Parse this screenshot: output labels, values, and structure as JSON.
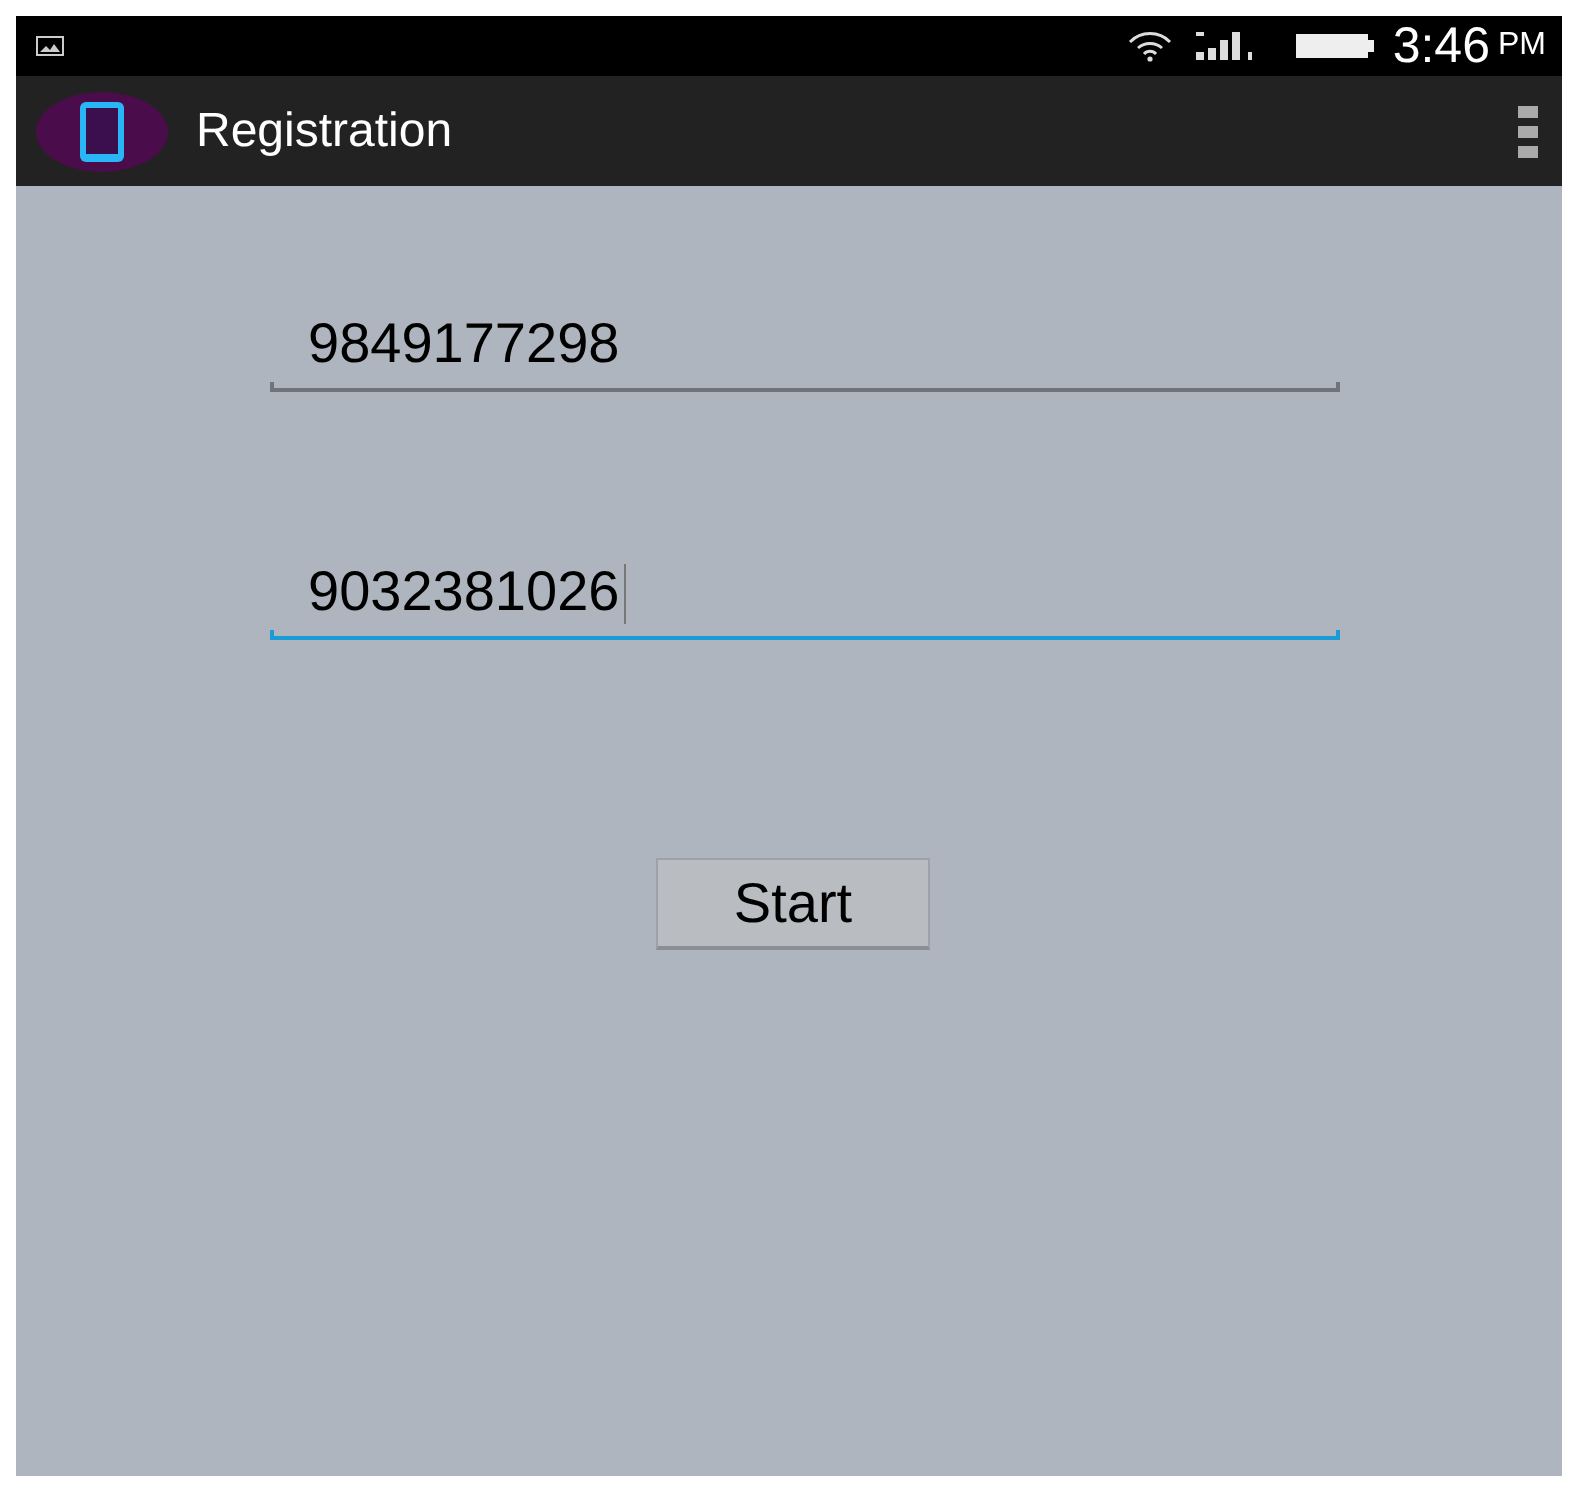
{
  "status_bar": {
    "time": "3:46",
    "period": "PM"
  },
  "app_bar": {
    "title": "Registration"
  },
  "fields": [
    {
      "value": "9849177298",
      "focused": false
    },
    {
      "value": "9032381026",
      "focused": true
    }
  ],
  "button": {
    "label": "Start"
  }
}
